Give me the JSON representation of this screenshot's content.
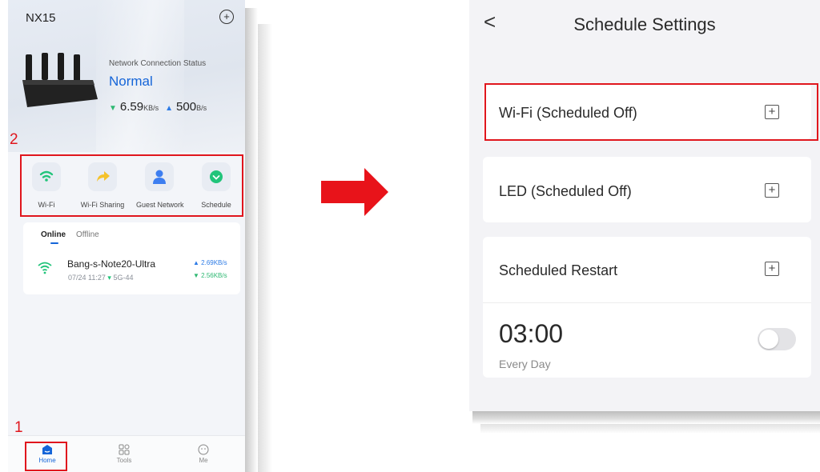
{
  "left_phone": {
    "device_name": "NX15",
    "network_status_label": "Network Connection Status",
    "network_status_value": "Normal",
    "download_speed": "6.59",
    "download_unit": "KB/s",
    "upload_speed": "500",
    "upload_unit": "B/s",
    "quick_actions": [
      {
        "label": "Wi-Fi",
        "icon": "wifi-icon",
        "color": "#21c47a"
      },
      {
        "label": "Wi-Fi Sharing",
        "icon": "share-arrow-icon",
        "color": "#f5c22b"
      },
      {
        "label": "Guest Network",
        "icon": "guest-user-icon",
        "color": "#3d7ef0"
      },
      {
        "label": "Schedule",
        "icon": "schedule-icon",
        "color": "#21c47a"
      }
    ],
    "tabs": {
      "online": "Online",
      "offline": "Offline"
    },
    "client": {
      "name": "Bang-s-Note20-Ultra",
      "time": "07/24 11:27",
      "band": "5G-44",
      "upload": "2.69KB/s",
      "download": "2.56KB/s"
    },
    "bottom_nav": [
      {
        "label": "Home",
        "icon": "home-icon"
      },
      {
        "label": "Tools",
        "icon": "tools-grid-icon"
      },
      {
        "label": "Me",
        "icon": "profile-face-icon"
      }
    ],
    "annotations": {
      "step_1": "1",
      "step_2": "2"
    }
  },
  "right_phone": {
    "back_label": "<",
    "title": "Schedule Settings",
    "items": [
      {
        "label": "Wi-Fi (Scheduled Off)"
      },
      {
        "label": "LED (Scheduled Off)"
      },
      {
        "label": "Scheduled Restart"
      }
    ],
    "restart_time": "03:00",
    "restart_repeat": "Every Day",
    "restart_toggle_on": false
  },
  "colors": {
    "annotation_red": "#e0161d",
    "accent_blue": "#1565d8",
    "arrow_red": "#e8131a"
  }
}
